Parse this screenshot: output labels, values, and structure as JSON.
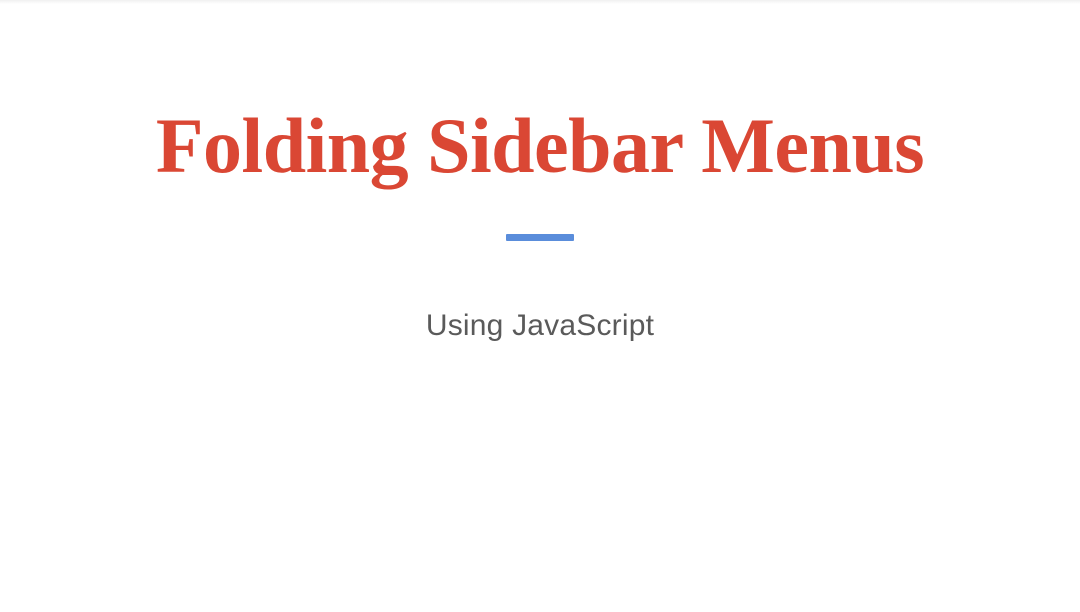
{
  "slide": {
    "title": "Folding Sidebar Menus",
    "subtitle": "Using JavaScript",
    "accent_color": "#da4734",
    "divider_color": "#5a8ddb"
  }
}
